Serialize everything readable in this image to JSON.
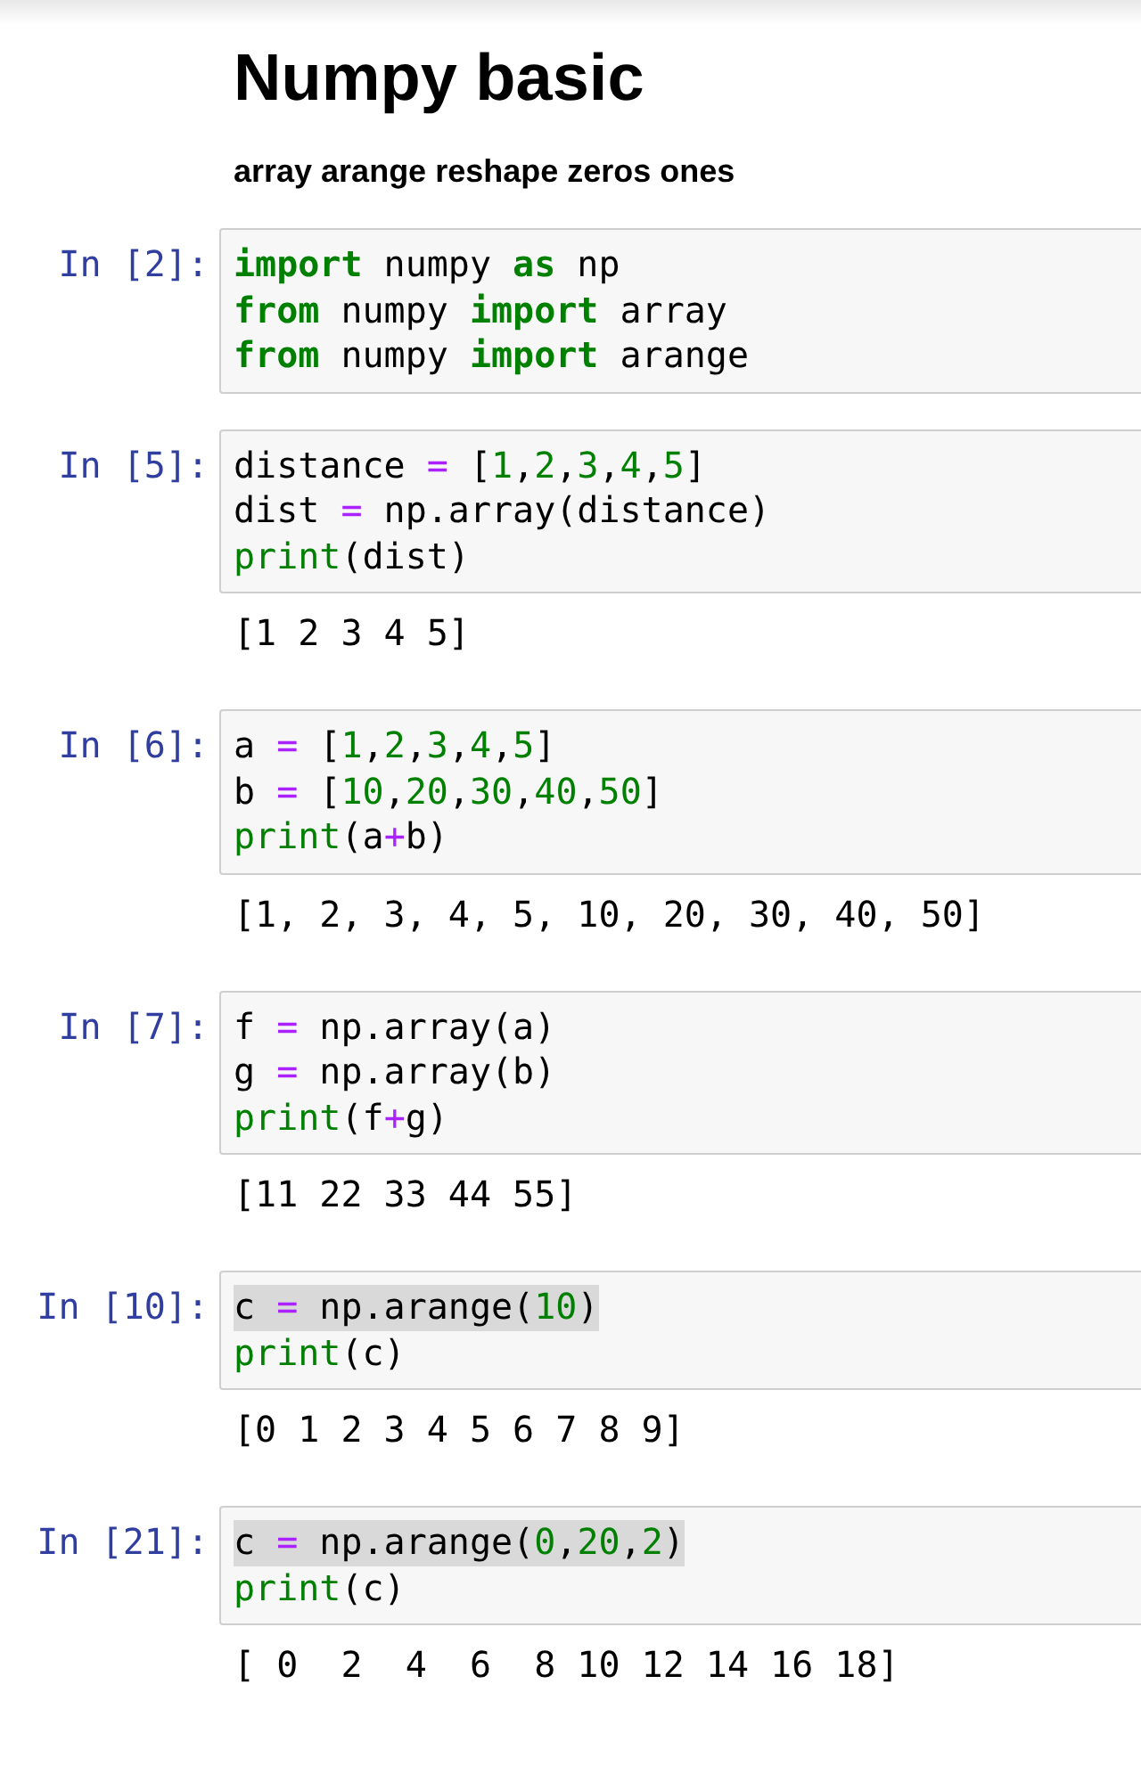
{
  "title": "Numpy basic",
  "subtitle": "array arange reshape zeros ones",
  "cells": [
    {
      "prompt": "In [2]:",
      "lines": [
        {
          "highlighted": false,
          "tokens": [
            {
              "text": "import",
              "kind": "keyword"
            },
            {
              "text": " numpy ",
              "kind": "name"
            },
            {
              "text": "as",
              "kind": "keyword"
            },
            {
              "text": " np",
              "kind": "name"
            }
          ]
        },
        {
          "highlighted": false,
          "tokens": [
            {
              "text": "from",
              "kind": "keyword"
            },
            {
              "text": " numpy ",
              "kind": "name"
            },
            {
              "text": "import",
              "kind": "keyword"
            },
            {
              "text": " array",
              "kind": "name"
            }
          ]
        },
        {
          "highlighted": false,
          "tokens": [
            {
              "text": "from",
              "kind": "keyword"
            },
            {
              "text": " numpy ",
              "kind": "name"
            },
            {
              "text": "import",
              "kind": "keyword"
            },
            {
              "text": " arange",
              "kind": "name"
            }
          ]
        }
      ]
    },
    {
      "prompt": "In [5]:",
      "lines": [
        {
          "highlighted": false,
          "tokens": [
            {
              "text": "distance ",
              "kind": "name"
            },
            {
              "text": "=",
              "kind": "operator"
            },
            {
              "text": " [",
              "kind": "name"
            },
            {
              "text": "1",
              "kind": "number"
            },
            {
              "text": ",",
              "kind": "name"
            },
            {
              "text": "2",
              "kind": "number"
            },
            {
              "text": ",",
              "kind": "name"
            },
            {
              "text": "3",
              "kind": "number"
            },
            {
              "text": ",",
              "kind": "name"
            },
            {
              "text": "4",
              "kind": "number"
            },
            {
              "text": ",",
              "kind": "name"
            },
            {
              "text": "5",
              "kind": "number"
            },
            {
              "text": "]",
              "kind": "name"
            }
          ]
        },
        {
          "highlighted": false,
          "tokens": [
            {
              "text": "dist ",
              "kind": "name"
            },
            {
              "text": "=",
              "kind": "operator"
            },
            {
              "text": " np.array(distance)",
              "kind": "name"
            }
          ]
        },
        {
          "highlighted": false,
          "tokens": [
            {
              "text": "print",
              "kind": "builtin"
            },
            {
              "text": "(dist)",
              "kind": "name"
            }
          ]
        }
      ],
      "output": "[1 2 3 4 5]"
    },
    {
      "prompt": "In [6]:",
      "lines": [
        {
          "highlighted": false,
          "tokens": [
            {
              "text": "a ",
              "kind": "name"
            },
            {
              "text": "=",
              "kind": "operator"
            },
            {
              "text": " [",
              "kind": "name"
            },
            {
              "text": "1",
              "kind": "number"
            },
            {
              "text": ",",
              "kind": "name"
            },
            {
              "text": "2",
              "kind": "number"
            },
            {
              "text": ",",
              "kind": "name"
            },
            {
              "text": "3",
              "kind": "number"
            },
            {
              "text": ",",
              "kind": "name"
            },
            {
              "text": "4",
              "kind": "number"
            },
            {
              "text": ",",
              "kind": "name"
            },
            {
              "text": "5",
              "kind": "number"
            },
            {
              "text": "]",
              "kind": "name"
            }
          ]
        },
        {
          "highlighted": false,
          "tokens": [
            {
              "text": "b ",
              "kind": "name"
            },
            {
              "text": "=",
              "kind": "operator"
            },
            {
              "text": " [",
              "kind": "name"
            },
            {
              "text": "10",
              "kind": "number"
            },
            {
              "text": ",",
              "kind": "name"
            },
            {
              "text": "20",
              "kind": "number"
            },
            {
              "text": ",",
              "kind": "name"
            },
            {
              "text": "30",
              "kind": "number"
            },
            {
              "text": ",",
              "kind": "name"
            },
            {
              "text": "40",
              "kind": "number"
            },
            {
              "text": ",",
              "kind": "name"
            },
            {
              "text": "50",
              "kind": "number"
            },
            {
              "text": "]",
              "kind": "name"
            }
          ]
        },
        {
          "highlighted": false,
          "tokens": [
            {
              "text": "print",
              "kind": "builtin"
            },
            {
              "text": "(a",
              "kind": "name"
            },
            {
              "text": "+",
              "kind": "operator"
            },
            {
              "text": "b)",
              "kind": "name"
            }
          ]
        }
      ],
      "output": "[1, 2, 3, 4, 5, 10, 20, 30, 40, 50]"
    },
    {
      "prompt": "In [7]:",
      "lines": [
        {
          "highlighted": false,
          "tokens": [
            {
              "text": "f ",
              "kind": "name"
            },
            {
              "text": "=",
              "kind": "operator"
            },
            {
              "text": " np.array(a)",
              "kind": "name"
            }
          ]
        },
        {
          "highlighted": false,
          "tokens": [
            {
              "text": "g ",
              "kind": "name"
            },
            {
              "text": "=",
              "kind": "operator"
            },
            {
              "text": " np.array(b)",
              "kind": "name"
            }
          ]
        },
        {
          "highlighted": false,
          "tokens": [
            {
              "text": "print",
              "kind": "builtin"
            },
            {
              "text": "(f",
              "kind": "name"
            },
            {
              "text": "+",
              "kind": "operator"
            },
            {
              "text": "g)",
              "kind": "name"
            }
          ]
        }
      ],
      "output": "[11 22 33 44 55]"
    },
    {
      "prompt": "In [10]:",
      "lines": [
        {
          "highlighted": true,
          "tokens": [
            {
              "text": "c ",
              "kind": "name"
            },
            {
              "text": "=",
              "kind": "operator"
            },
            {
              "text": " np.arange(",
              "kind": "name"
            },
            {
              "text": "10",
              "kind": "number"
            },
            {
              "text": ")",
              "kind": "name"
            }
          ]
        },
        {
          "highlighted": false,
          "tokens": [
            {
              "text": "print",
              "kind": "builtin"
            },
            {
              "text": "(c)",
              "kind": "name"
            }
          ]
        }
      ],
      "output": "[0 1 2 3 4 5 6 7 8 9]"
    },
    {
      "prompt": "In [21]:",
      "lines": [
        {
          "highlighted": true,
          "tokens": [
            {
              "text": "c ",
              "kind": "name"
            },
            {
              "text": "=",
              "kind": "operator"
            },
            {
              "text": " np.arange(",
              "kind": "name"
            },
            {
              "text": "0",
              "kind": "number"
            },
            {
              "text": ",",
              "kind": "name"
            },
            {
              "text": "20",
              "kind": "number"
            },
            {
              "text": ",",
              "kind": "name"
            },
            {
              "text": "2",
              "kind": "number"
            },
            {
              "text": ")",
              "kind": "name"
            }
          ]
        },
        {
          "highlighted": false,
          "tokens": [
            {
              "text": "print",
              "kind": "builtin"
            },
            {
              "text": "(c)",
              "kind": "name"
            }
          ]
        }
      ],
      "output": "[ 0  2  4  6  8 10 12 14 16 18]"
    }
  ]
}
